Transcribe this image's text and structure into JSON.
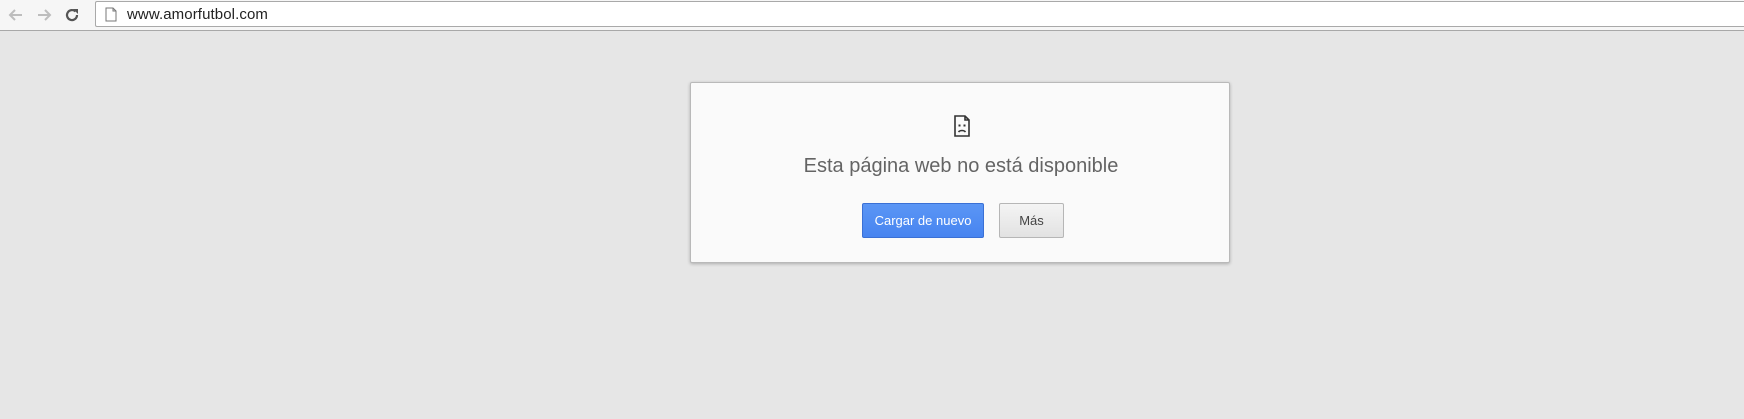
{
  "browser": {
    "url": "www.amorfutbol.com",
    "icons": {
      "back": "back-arrow-icon",
      "forward": "forward-arrow-icon",
      "reload": "reload-icon",
      "page": "page-icon"
    }
  },
  "error_page": {
    "title": "Esta página web no está disponible",
    "icon": "sad-page-icon",
    "reload_button": "Cargar de nuevo",
    "more_button": "Más"
  },
  "colors": {
    "background": "#e6e6e6",
    "card": "#fafafa",
    "primary_button": "#4d8bf5",
    "title_text": "#646464"
  }
}
